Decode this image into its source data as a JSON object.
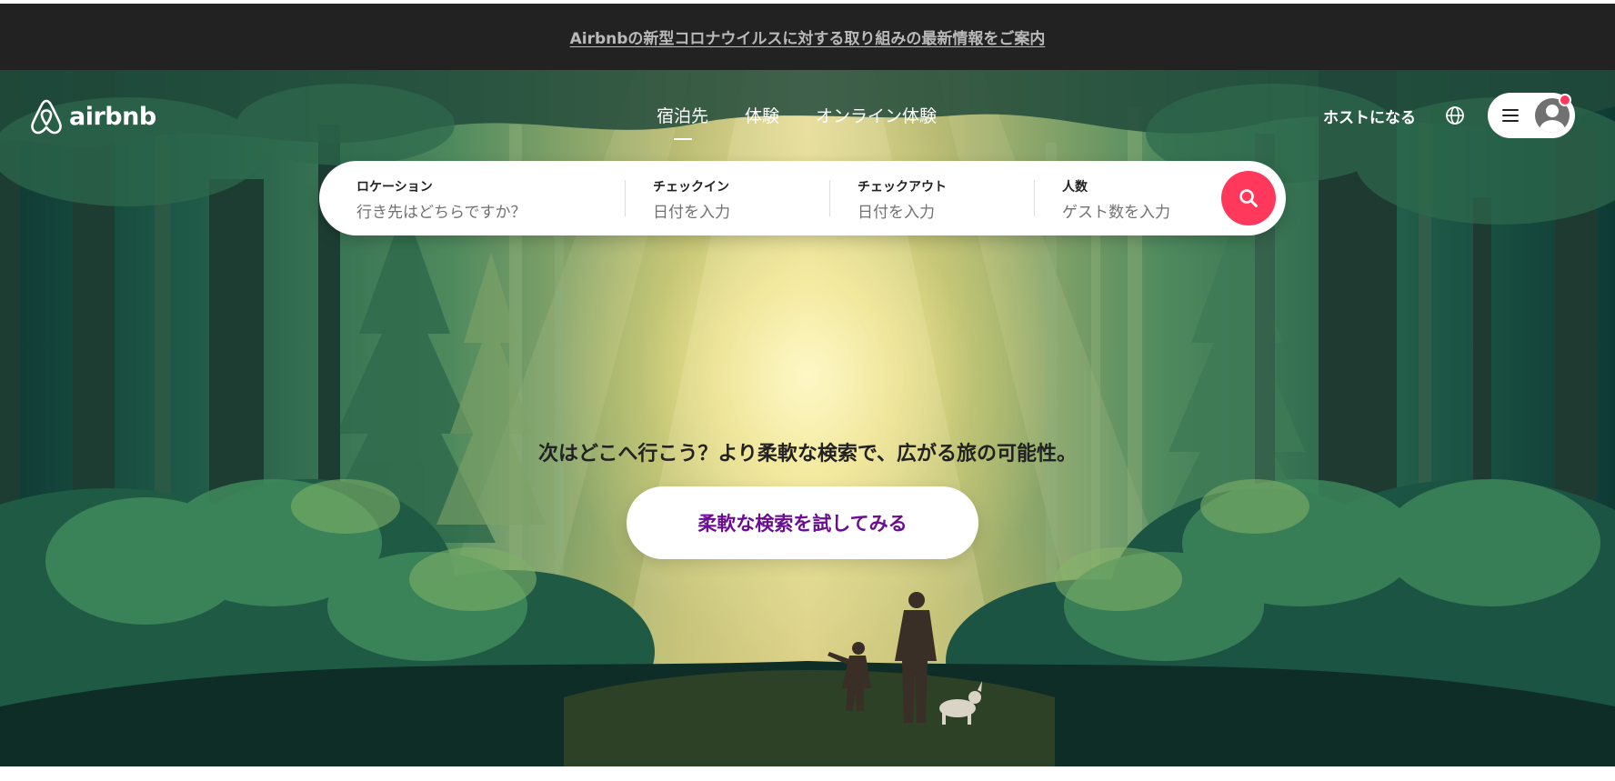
{
  "banner": {
    "text": "Airbnbの新型コロナウイルスに対する取り組みの最新情報をご案内"
  },
  "header": {
    "logo_text": "airbnb",
    "tabs": [
      {
        "label": "宿泊先",
        "active": true
      },
      {
        "label": "体験",
        "active": false
      },
      {
        "label": "オンライン体験",
        "active": false
      }
    ],
    "host_label": "ホストになる",
    "globe_icon": "globe-icon",
    "menu_icon": "hamburger-icon",
    "avatar_icon": "user-avatar-icon"
  },
  "search": {
    "location": {
      "label": "ロケーション",
      "placeholder": "行き先はどちらですか？"
    },
    "checkin": {
      "label": "チェックイン",
      "placeholder": "日付を入力"
    },
    "checkout": {
      "label": "チェックアウト",
      "placeholder": "日付を入力"
    },
    "guests": {
      "label": "人数",
      "placeholder": "ゲスト数を入力"
    },
    "button_icon": "search-icon"
  },
  "hero": {
    "tagline": "次はどこへ行こう？より柔軟な検索で、広がる旅の可能性。",
    "cta_label": "柔軟な検索を試してみる"
  },
  "colors": {
    "brand": "#ff385c",
    "cta_text": "#6a0d91",
    "banner_bg": "#222222"
  }
}
